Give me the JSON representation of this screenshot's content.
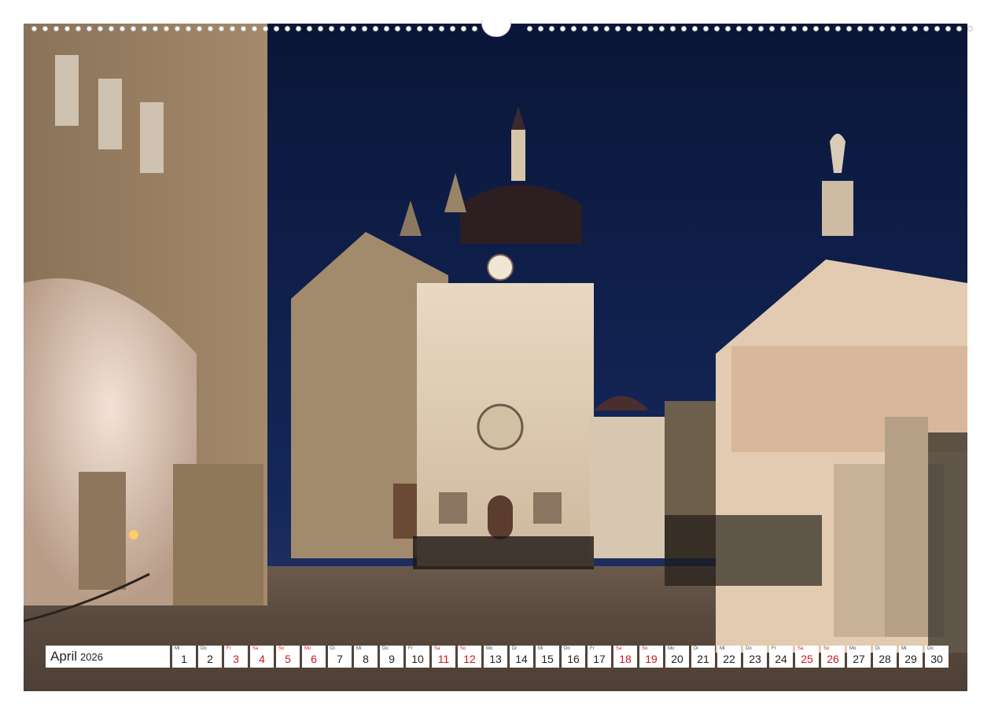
{
  "calendar": {
    "month": "April",
    "year": "2026",
    "days": [
      {
        "wd": "Mi",
        "n": "1",
        "weekend": false
      },
      {
        "wd": "Do",
        "n": "2",
        "weekend": false
      },
      {
        "wd": "Fr",
        "n": "3",
        "weekend": true
      },
      {
        "wd": "Sa",
        "n": "4",
        "weekend": true
      },
      {
        "wd": "So",
        "n": "5",
        "weekend": true
      },
      {
        "wd": "Mo",
        "n": "6",
        "weekend": true
      },
      {
        "wd": "Di",
        "n": "7",
        "weekend": false
      },
      {
        "wd": "Mi",
        "n": "8",
        "weekend": false
      },
      {
        "wd": "Do",
        "n": "9",
        "weekend": false
      },
      {
        "wd": "Fr",
        "n": "10",
        "weekend": false
      },
      {
        "wd": "Sa",
        "n": "11",
        "weekend": true
      },
      {
        "wd": "So",
        "n": "12",
        "weekend": true
      },
      {
        "wd": "Mo",
        "n": "13",
        "weekend": false
      },
      {
        "wd": "Di",
        "n": "14",
        "weekend": false
      },
      {
        "wd": "Mi",
        "n": "15",
        "weekend": false
      },
      {
        "wd": "Do",
        "n": "16",
        "weekend": false
      },
      {
        "wd": "Fr",
        "n": "17",
        "weekend": false
      },
      {
        "wd": "Sa",
        "n": "18",
        "weekend": true
      },
      {
        "wd": "So",
        "n": "19",
        "weekend": true
      },
      {
        "wd": "Mo",
        "n": "20",
        "weekend": false
      },
      {
        "wd": "Di",
        "n": "21",
        "weekend": false
      },
      {
        "wd": "Mi",
        "n": "22",
        "weekend": false
      },
      {
        "wd": "Do",
        "n": "23",
        "weekend": false
      },
      {
        "wd": "Fr",
        "n": "24",
        "weekend": false
      },
      {
        "wd": "Sa",
        "n": "25",
        "weekend": true
      },
      {
        "wd": "So",
        "n": "26",
        "weekend": true
      },
      {
        "wd": "Mo",
        "n": "27",
        "weekend": false
      },
      {
        "wd": "Di",
        "n": "28",
        "weekend": false
      },
      {
        "wd": "Mi",
        "n": "29",
        "weekend": false
      },
      {
        "wd": "Do",
        "n": "30",
        "weekend": false
      }
    ]
  },
  "colors": {
    "weekend": "#d2141e",
    "sky": "#0d1a3d",
    "stone": "#b59a7a"
  }
}
